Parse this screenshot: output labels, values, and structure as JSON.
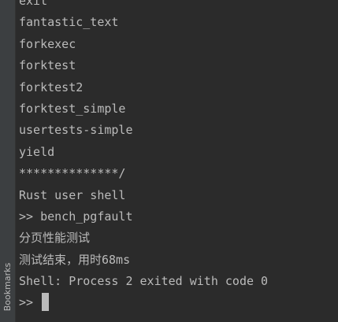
{
  "sidebar": {
    "bookmarks_label": "Bookmarks"
  },
  "terminal": {
    "lines": [
      "exit",
      "fantastic_text",
      "forkexec",
      "forktest",
      "forktest2",
      "forktest_simple",
      "usertests-simple",
      "yield",
      "**************/",
      "Rust user shell",
      ">> bench_pgfault",
      "分页性能测试",
      "测试结束，用时68ms",
      "Shell: Process 2 exited with code 0"
    ],
    "prompt": ">> "
  }
}
